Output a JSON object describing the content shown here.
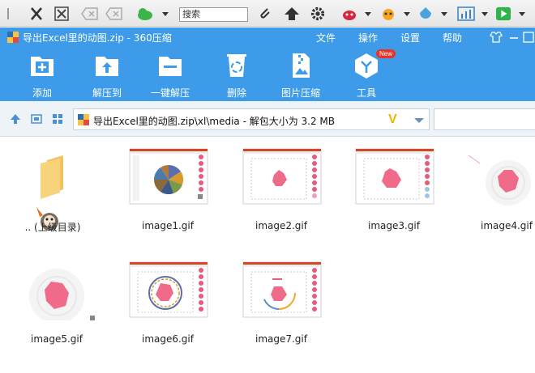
{
  "systop": {
    "search_label": "搜索"
  },
  "window": {
    "title": "导出Excel里的动图.zip - 360压缩",
    "menu": [
      "文件",
      "操作",
      "设置",
      "帮助"
    ]
  },
  "toolbar": {
    "add": "添加",
    "extract_to": "解压到",
    "one_click_extract": "一键解压",
    "delete": "删除",
    "image_compress": "图片压缩",
    "tools": "工具",
    "new_badge": "New"
  },
  "address": {
    "path": "导出Excel里的动图.zip\\xl\\media - 解包大小为 3.2 MB"
  },
  "files": [
    {
      "name": ".. (上级目录)",
      "kind": "parent-folder"
    },
    {
      "name": "image1.gif",
      "kind": "thumb-slide-pie"
    },
    {
      "name": "image2.gif",
      "kind": "thumb-slide-rose"
    },
    {
      "name": "image3.gif",
      "kind": "thumb-slide-rose"
    },
    {
      "name": "image4.gif",
      "kind": "thumb-rose"
    },
    {
      "name": "image5.gif",
      "kind": "thumb-rose"
    },
    {
      "name": "image6.gif",
      "kind": "thumb-slide-ring"
    },
    {
      "name": "image7.gif",
      "kind": "thumb-slide-arc"
    }
  ],
  "colors": {
    "ribbon": "#3d9be9",
    "addr_bg": "#eef3f8",
    "accent_pink": "#f06a8a"
  }
}
